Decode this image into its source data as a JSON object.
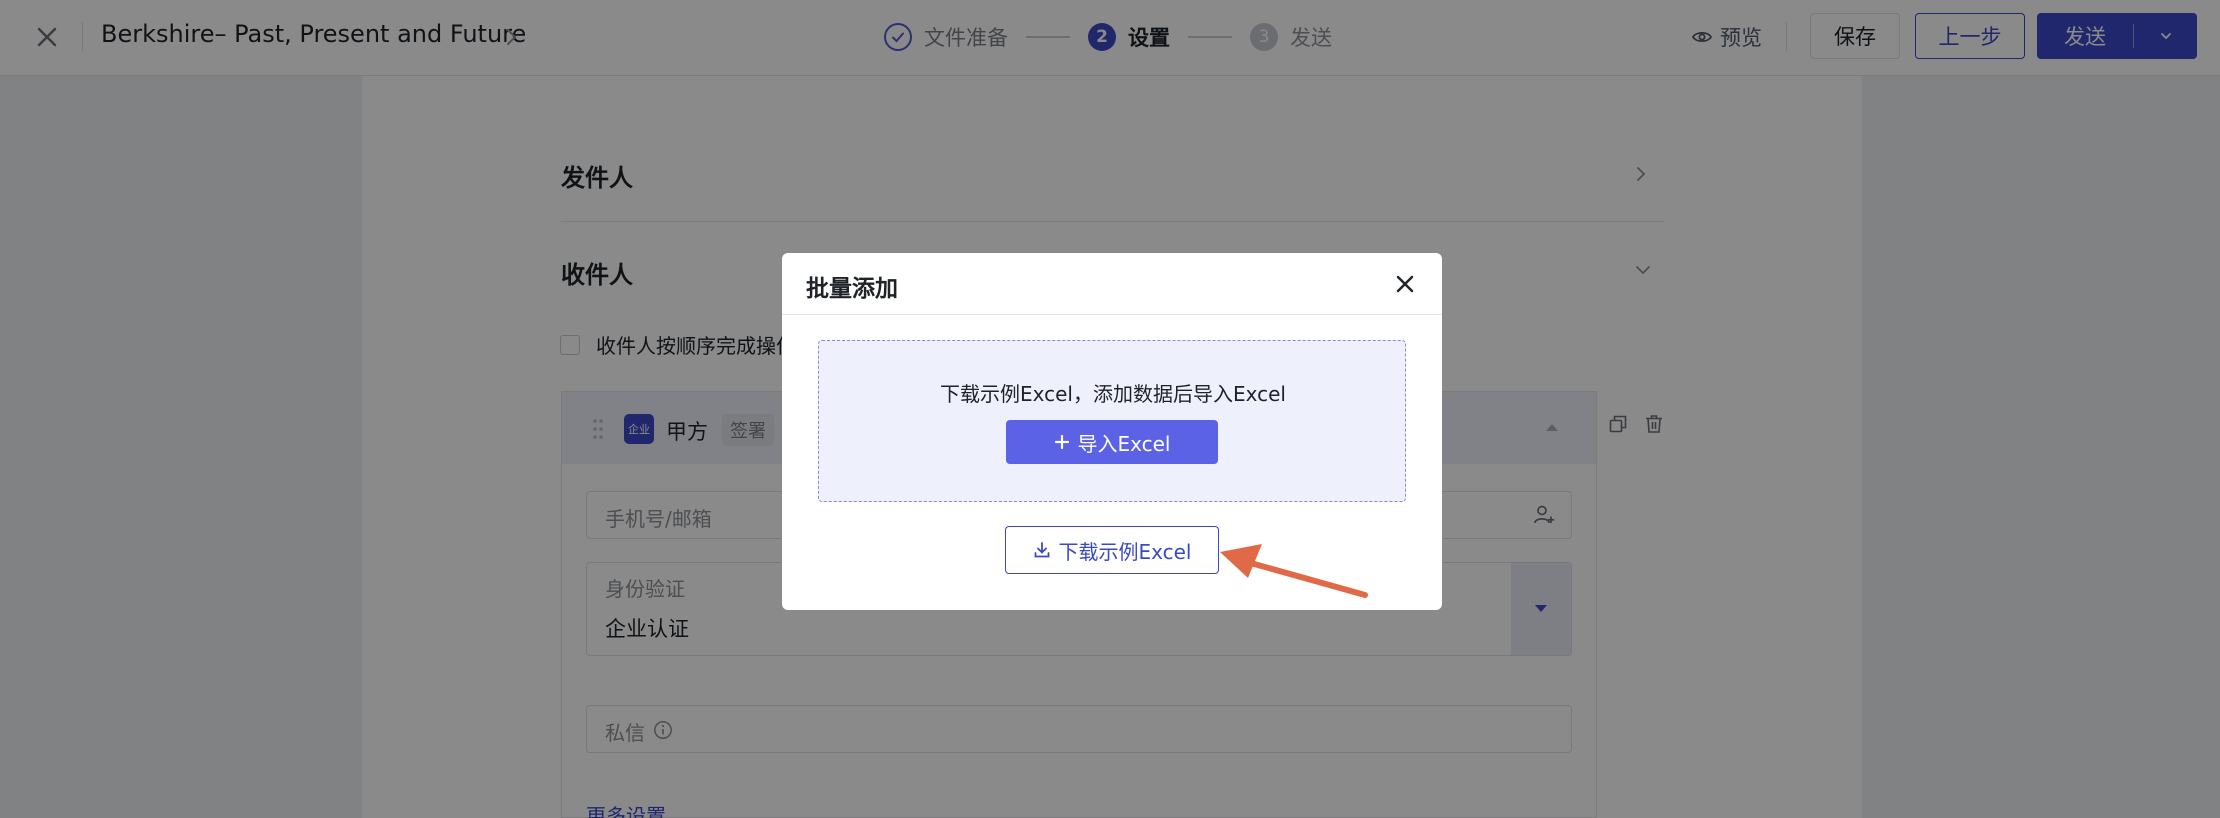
{
  "header": {
    "doc_title": "Berkshire– Past, Present and Future",
    "steps": [
      {
        "label": "文件准备",
        "state": "done"
      },
      {
        "number": "2",
        "label": "设置",
        "state": "active"
      },
      {
        "number": "3",
        "label": "发送",
        "state": "pending"
      }
    ],
    "preview_label": "预览",
    "save_label": "保存",
    "prev_label": "上一步",
    "send_label": "发送"
  },
  "sections": {
    "sender_title": "发件人",
    "recipient_title": "收件人",
    "order_checkbox_label": "收件人按顺序完成操作"
  },
  "signer": {
    "badge": "企业",
    "party_name": "甲方",
    "action_tag": "签署",
    "contact_placeholder": "手机号/邮箱",
    "identity_label": "身份验证",
    "identity_value": "企业认证",
    "message_placeholder": "私信",
    "more_settings": "更多设置"
  },
  "modal": {
    "title": "批量添加",
    "drop_hint": "下载示例Excel，添加数据后导入Excel",
    "import_label": "导入Excel",
    "download_label": "下载示例Excel"
  },
  "colors": {
    "brand": "#3b49c7",
    "import_button": "#5b62e6",
    "annotation_arrow": "#e06a48",
    "overlay": "rgba(0,0,0,0.46)"
  }
}
